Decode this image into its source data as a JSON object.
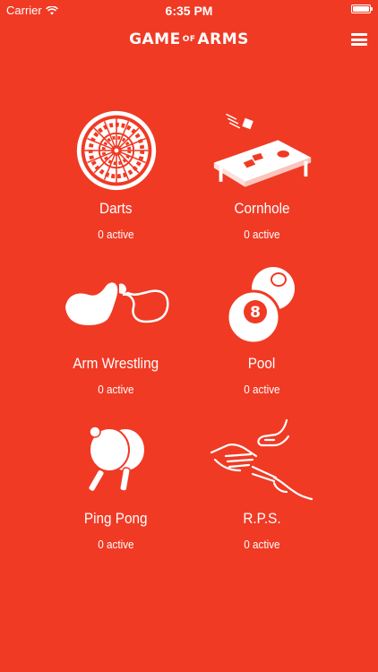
{
  "status": {
    "carrier": "Carrier",
    "time": "6:35 PM"
  },
  "app": {
    "logo": {
      "part1": "GAME",
      "part2": "OF",
      "part3": "ARMS"
    },
    "menu_icon": "hamburger-menu-icon"
  },
  "games": [
    {
      "name": "Darts",
      "count": "0 active",
      "icon": "dartboard-icon"
    },
    {
      "name": "Cornhole",
      "count": "0 active",
      "icon": "cornhole-board-icon"
    },
    {
      "name": "Arm Wrestling",
      "count": "0 active",
      "icon": "arm-wrestling-icon"
    },
    {
      "name": "Pool",
      "count": "0 active",
      "icon": "billiard-balls-icon"
    },
    {
      "name": "Ping Pong",
      "count": "0 active",
      "icon": "ping-pong-paddles-icon"
    },
    {
      "name": "R.P.S.",
      "count": "0 active",
      "icon": "rock-paper-scissors-icon"
    }
  ],
  "colors": {
    "background": "#F03A24",
    "foreground": "#FFFFFF"
  }
}
